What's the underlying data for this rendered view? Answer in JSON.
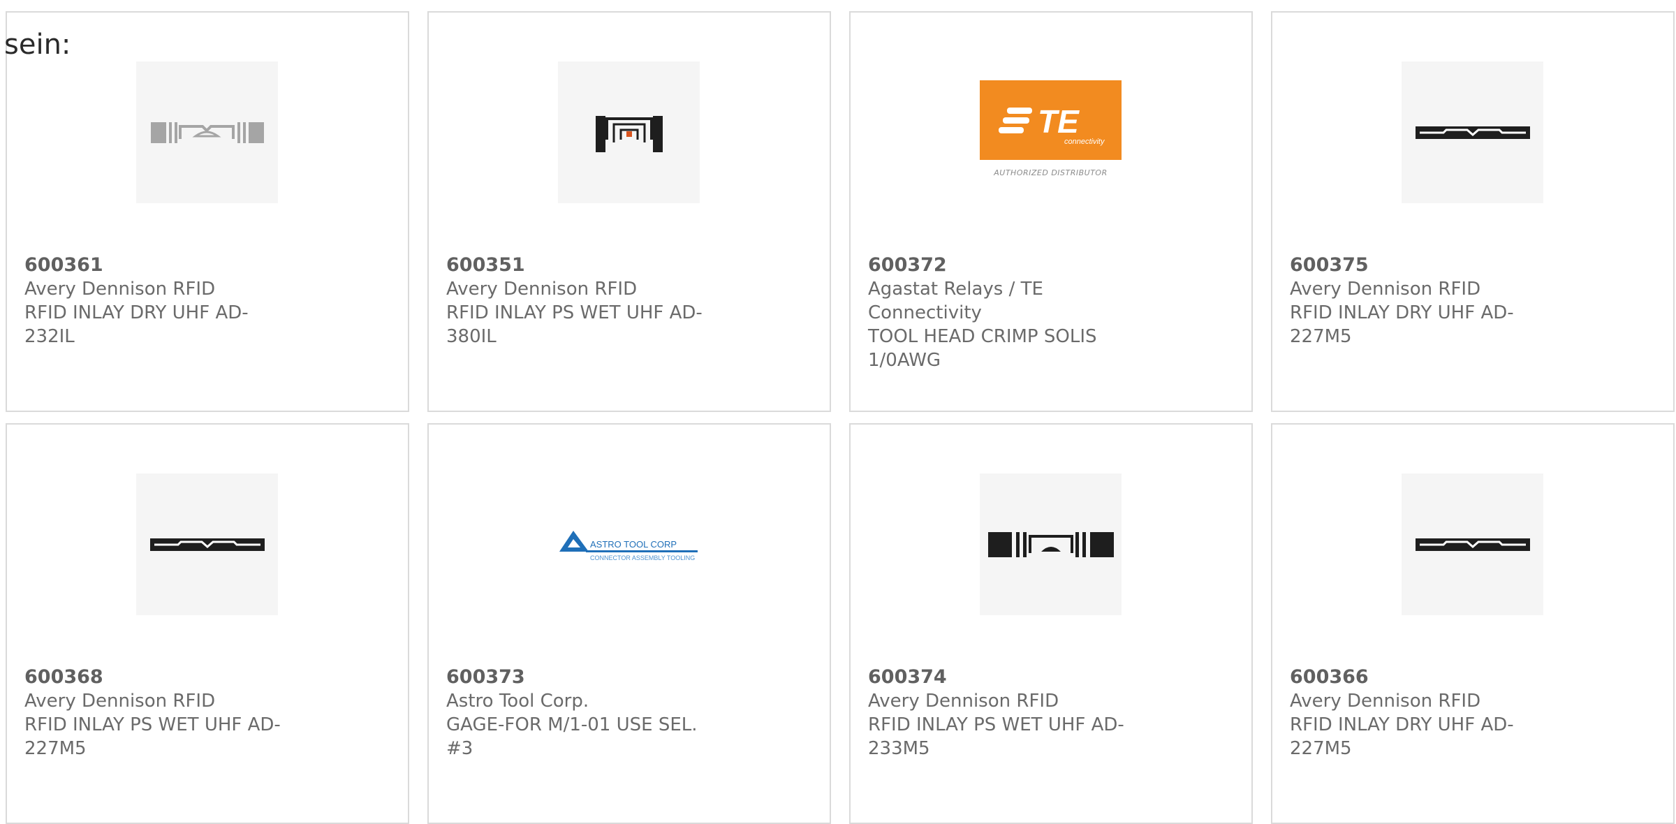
{
  "intro_text": "sein:",
  "colors": {
    "accent": "#e2421b",
    "bar": "#3d3d3d",
    "te_orange": "#f28b20"
  },
  "products": [
    {
      "part_number": "600361",
      "manufacturer": "Avery Dennison RFID",
      "description": "RFID INLAY DRY UHF AD-232IL",
      "image": "rfid-inlay-grey-icon"
    },
    {
      "part_number": "600351",
      "manufacturer": "Avery Dennison RFID",
      "description": "RFID INLAY PS WET UHF AD-380IL",
      "image": "rfid-inlay-compact-icon"
    },
    {
      "part_number": "600372",
      "manufacturer": "Agastat Relays / TE Connectivity",
      "description": "TOOL HEAD CRIMP SOLIS 1/0AWG",
      "image": "te-connectivity-logo",
      "logo_text": {
        "brand": "TE",
        "sub": "connectivity",
        "tagline": "AUTHORIZED DISTRIBUTOR"
      }
    },
    {
      "part_number": "600375",
      "manufacturer": "Avery Dennison RFID",
      "description": "RFID INLAY DRY UHF AD-227M5",
      "image": "rfid-inlay-slim-icon"
    },
    {
      "part_number": "600368",
      "manufacturer": "Avery Dennison RFID",
      "description": "RFID INLAY PS WET UHF AD-227M5",
      "image": "rfid-inlay-slim-icon"
    },
    {
      "part_number": "600373",
      "manufacturer": "Astro Tool Corp.",
      "description": "GAGE-FOR M/1-01 USE SEL. #3",
      "image": "astro-tool-logo",
      "logo_text": {
        "brand": "ASTRO TOOL CORP",
        "sub": "CONNECTOR ASSEMBLY TOOLING"
      }
    },
    {
      "part_number": "600374",
      "manufacturer": "Avery Dennison RFID",
      "description": "RFID INLAY PS WET UHF AD-233M5",
      "image": "rfid-inlay-black-icon"
    },
    {
      "part_number": "600366",
      "manufacturer": "Avery Dennison RFID",
      "description": "RFID INLAY DRY UHF AD-227M5",
      "image": "rfid-inlay-slim-icon"
    }
  ]
}
